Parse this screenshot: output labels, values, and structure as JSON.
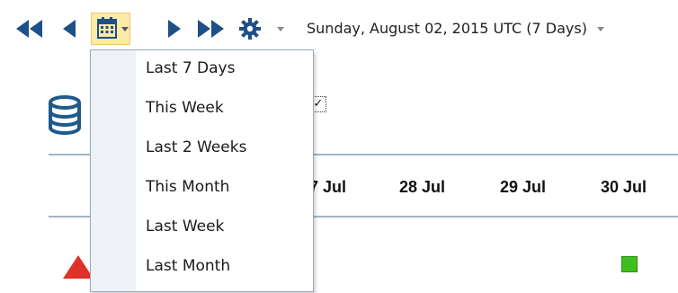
{
  "toolbar": {
    "buttons": [
      {
        "name": "first-page-icon"
      },
      {
        "name": "previous-icon"
      },
      {
        "name": "calendar-icon"
      },
      {
        "name": "next-icon"
      },
      {
        "name": "last-page-icon"
      },
      {
        "name": "gear-icon"
      }
    ],
    "date_range_label": "Sunday, August 02, 2015 UTC (7 Days)"
  },
  "colors": {
    "nav_icon": "#1e4f86",
    "calendar_button_bg": "#fde9a8",
    "status_ok": "#3fbf1f",
    "warning": "#e0302a",
    "divider": "#9fb4c9"
  },
  "table": {
    "column_headers": [
      "7 Jul",
      "28 Jul",
      "29 Jul",
      "30 Jul"
    ]
  },
  "checkbox_glyph": "✓",
  "menu": {
    "items": [
      {
        "label": "Last 7 Days"
      },
      {
        "label": "This Week"
      },
      {
        "label": "Last 2 Weeks"
      },
      {
        "label": "This Month"
      },
      {
        "label": "Last Week"
      },
      {
        "label": "Last Month"
      }
    ]
  }
}
